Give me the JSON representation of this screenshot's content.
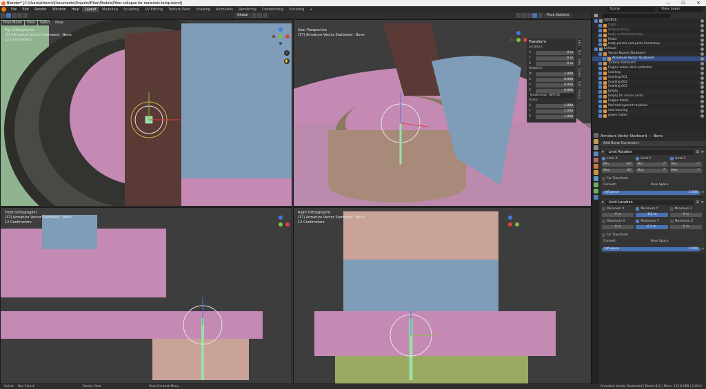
{
  "window": {
    "title": "Blender* [C:\\Users\\Artemis\\Documents\\Projects\\Filter\\Models\\Filter collapse for materials.temp.blend]",
    "controls": [
      "—",
      "☐",
      "✕"
    ]
  },
  "menu": [
    "File",
    "Edit",
    "Render",
    "Window",
    "Help"
  ],
  "workspaces": [
    "Layout",
    "Modeling",
    "Sculpting",
    "UV Editing",
    "Texture Paint",
    "Shading",
    "Animation",
    "Rendering",
    "Compositing",
    "Scripting"
  ],
  "active_workspace": "Layout",
  "scene": {
    "label": "Scene",
    "view_layer": "View Layer"
  },
  "header3d": {
    "mode": "Pose Mode",
    "menus": [
      "View",
      "Select",
      "Pose"
    ],
    "orientation": "Global",
    "pose_options": "Pose Options"
  },
  "viewports": {
    "tl": {
      "view": "Top Orthographic",
      "object": "(37) Armature Vector Starboard : Bone",
      "units": "12 Centimeters"
    },
    "tr": {
      "view": "User Perspective",
      "object": "(37) Armature Vector Starboard : Bone"
    },
    "bl": {
      "view": "Front Orthographic",
      "object": "(37) Armature Vector Starboard : Bone",
      "units": "12 Centimeters"
    },
    "br": {
      "view": "Right Orthographic",
      "object": "(37) Armature Vector Starboard : Bone",
      "units": "12 Centimeters"
    }
  },
  "transform_panel": {
    "title": "Transform",
    "location_label": "Location:",
    "location": [
      {
        "k": "X",
        "v": "0 m"
      },
      {
        "k": "Y",
        "v": "0 m"
      },
      {
        "k": "Z",
        "v": "0 m"
      }
    ],
    "rotation_label": "Rotation:",
    "rotation": [
      {
        "k": "W",
        "v": "1.000"
      },
      {
        "k": "X",
        "v": "0.000"
      },
      {
        "k": "Y",
        "v": "0.000"
      },
      {
        "k": "Z",
        "v": "0.000"
      }
    ],
    "mode": "Quaternion (WXYZ)",
    "scale_label": "Scale:",
    "scale": [
      {
        "k": "X",
        "v": "1.000"
      },
      {
        "k": "Y",
        "v": "1.000"
      },
      {
        "k": "Z",
        "v": "1.000"
      }
    ]
  },
  "side_tabs": [
    "Item",
    "Tool",
    "View",
    "Create",
    "Edit",
    "Physics"
  ],
  "outliner": {
    "items": [
      {
        "label": "SOURCE",
        "type": "col",
        "indent": 0
      },
      {
        "label": "Light",
        "type": "tri",
        "indent": 1,
        "dim": true
      },
      {
        "label": "body primary",
        "type": "tri",
        "indent": 1,
        "dim": true
      },
      {
        "label": "body surfaceSeconday",
        "type": "tri",
        "indent": 1,
        "dim": true
      },
      {
        "label": "Probe",
        "type": "tri",
        "indent": 1
      },
      {
        "label": "body panels and parts Secondary",
        "type": "tri",
        "indent": 1
      },
      {
        "label": "Exhaust",
        "type": "col",
        "indent": 0
      },
      {
        "label": "Vector Nozzel Starboard",
        "type": "tri",
        "indent": 1
      },
      {
        "label": "Armature Vector Starboard",
        "type": "tri",
        "indent": 2,
        "selected": true
      },
      {
        "label": "Turbine starboard",
        "type": "tri",
        "indent": 1
      },
      {
        "label": "Engine blade stick controller",
        "type": "tri",
        "indent": 1
      },
      {
        "label": "Cowling",
        "type": "tri",
        "indent": 1
      },
      {
        "label": "Cowling.001",
        "type": "tri",
        "indent": 1
      },
      {
        "label": "Cowling.002",
        "type": "tri",
        "indent": 1
      },
      {
        "label": "Cowling.003",
        "type": "tri",
        "indent": 1
      },
      {
        "label": "Empty",
        "type": "tri",
        "indent": 1
      },
      {
        "label": "Empty for mirror cants",
        "type": "tri",
        "indent": 1
      },
      {
        "label": "Engine blade",
        "type": "tri",
        "indent": 1
      },
      {
        "label": "Pod deployment modules",
        "type": "tri",
        "indent": 1
      },
      {
        "label": "seal housing",
        "type": "tri",
        "indent": 1
      },
      {
        "label": "power tubes",
        "type": "tri",
        "indent": 1
      }
    ]
  },
  "properties": {
    "breadcrumb": [
      "Armature Vector Starboard",
      "Bone"
    ],
    "add_constraint": "Add Bone Constraint",
    "limit_rotation": {
      "name": "Limit Rotation",
      "axes": [
        "Limit X",
        "Limit Y",
        "Limit Z"
      ],
      "min_label": "Min",
      "max_label": "Max",
      "x": {
        "min": "-83°",
        "max": "83°"
      },
      "y": {
        "min": "-7°",
        "max": "7°"
      },
      "z": {
        "min": "-7°",
        "max": "7°"
      },
      "for_transform": "For Transform",
      "convert": "Convert:",
      "space": "Pose Space",
      "influence": "Influence",
      "influence_value": "1.000"
    },
    "limit_location": {
      "name": "Limit Location",
      "rows": [
        [
          "Minimum X",
          "Minimum Y",
          "Minimum Z"
        ],
        [
          "Maximum X",
          "Maximum Y",
          "Maximum Z"
        ]
      ],
      "values": [
        [
          "0 m",
          "-0.1 m",
          "0 m"
        ],
        [
          "0 m",
          "0.1 m",
          "0 m"
        ]
      ],
      "for_transform": "For Transform",
      "convert": "Convert:",
      "space": "Pose Space",
      "influence": "Influence",
      "influence_value": "1.000"
    }
  },
  "status": {
    "left": [
      "Select",
      "Box Select",
      "Rotate View",
      "Pose Context Menu"
    ],
    "right": "Armature Vector Starboard | Bones:1/2 | Mem: 131.8 MiB | 2.83.4"
  },
  "colors": {
    "pink": "#c48ab4",
    "salmon": "#c9a298",
    "blue": "#7f9db8",
    "brown": "#5a3a35",
    "green": "#84ad84",
    "olive": "#9aaa63",
    "tan": "#b0947a"
  }
}
